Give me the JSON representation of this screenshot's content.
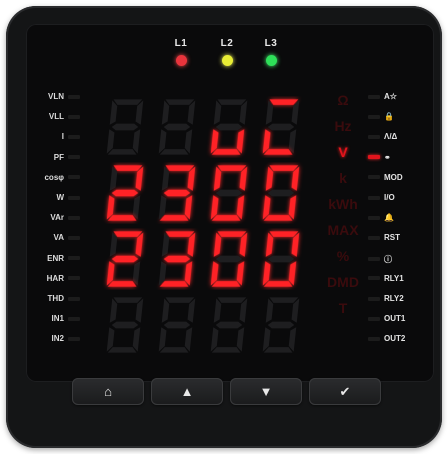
{
  "phase_leds": [
    {
      "label": "L1",
      "color": "#e9343c"
    },
    {
      "label": "L2",
      "color": "#e9ee35"
    },
    {
      "label": "L3",
      "color": "#2ee059"
    }
  ],
  "left_params": [
    "VLN",
    "VLL",
    "I",
    "PF",
    "cosφ",
    "W",
    "VAr",
    "VA",
    "ENR",
    "HAR",
    "THD",
    "IN1",
    "IN2"
  ],
  "right_params": [
    {
      "label": "A☆",
      "on": false
    },
    {
      "label": "🔒",
      "on": false
    },
    {
      "label": "Λ/Δ",
      "on": false
    },
    {
      "label": "⚭",
      "on": true
    },
    {
      "label": "MOD",
      "on": false
    },
    {
      "label": "I/O",
      "on": false
    },
    {
      "label": "🔔",
      "on": false
    },
    {
      "label": "RST",
      "on": false
    },
    {
      "label": "ⓘ",
      "on": false
    },
    {
      "label": "RLY1",
      "on": false
    },
    {
      "label": "RLY2",
      "on": false
    },
    {
      "label": "OUT1",
      "on": false
    },
    {
      "label": "OUT2",
      "on": false
    }
  ],
  "units": [
    {
      "label": "Ω",
      "on": false
    },
    {
      "label": "Hz",
      "on": false
    },
    {
      "label": "V",
      "on": true
    },
    {
      "label": "k",
      "on": false
    },
    {
      "label": "kWh",
      "on": false
    },
    {
      "label": "MAX",
      "on": false
    },
    {
      "label": "%",
      "on": false
    },
    {
      "label": "DMD",
      "on": false
    },
    {
      "label": "T",
      "on": false
    }
  ],
  "display_rows": [
    {
      "text": "uT"
    },
    {
      "text": "2300"
    },
    {
      "text": "2300"
    },
    {
      "text": ""
    }
  ],
  "buttons": [
    {
      "name": "home",
      "icon": "⌂"
    },
    {
      "name": "up",
      "icon": "▲"
    },
    {
      "name": "down",
      "icon": "▼"
    },
    {
      "name": "enter",
      "icon": "✔"
    }
  ],
  "colors": {
    "segment_on": "#ff2226",
    "segment_off": "#1e1e20"
  }
}
